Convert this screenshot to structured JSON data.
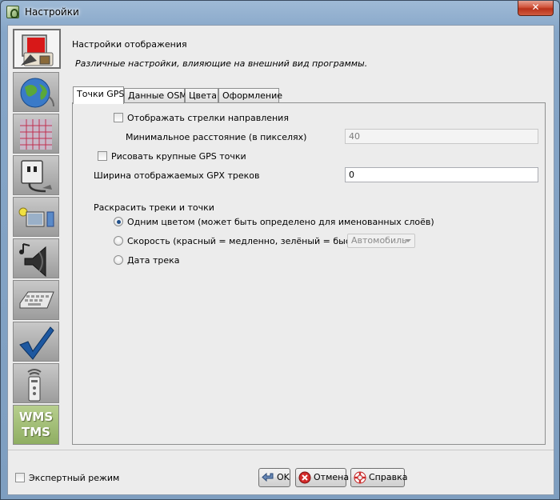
{
  "window": {
    "title": "Настройки",
    "close_glyph": "✕"
  },
  "categories": [
    {
      "icon": "display-settings-icon"
    },
    {
      "icon": "globe-icon"
    },
    {
      "icon": "projection-grid-icon"
    },
    {
      "icon": "plugin-icon"
    },
    {
      "icon": "folders-icon"
    },
    {
      "icon": "audio-icon"
    },
    {
      "icon": "keyboard-icon"
    },
    {
      "icon": "validator-checkmark-icon"
    },
    {
      "icon": "remote-control-icon"
    },
    {
      "icon": "wms-tms-icon",
      "label_line1": "WMS",
      "label_line2": "TMS"
    }
  ],
  "panel": {
    "title": "Настройки отображения",
    "description": "Различные настройки, влияющие на внешний вид программы."
  },
  "tabs": [
    {
      "label": "Точки GPS",
      "active": true
    },
    {
      "label": "Данные OSM",
      "active": false
    },
    {
      "label": "Цвета",
      "active": false
    },
    {
      "label": "Оформление",
      "active": false
    }
  ],
  "gps": {
    "show_direction_arrows_label": "Отображать стрелки направления",
    "show_direction_arrows": false,
    "min_distance_label": "Минимальное расстояние (в пикселях)",
    "min_distance_value": "40",
    "draw_large_points_label": "Рисовать крупные GPS точки",
    "draw_large_points": false,
    "track_width_label": "Ширина отображаемых GPX треков",
    "track_width_value": "0",
    "color_section_label": "Раскрасить треки и точки",
    "color_options": [
      {
        "label": "Одним цветом (может быть определено для именованных слоёв)",
        "selected": true
      },
      {
        "label": "Скорость (красный = медленно, зелёный = быстро)",
        "selected": false
      },
      {
        "label": "Дата трека",
        "selected": false
      }
    ],
    "speed_profile_value": "Автомобиль"
  },
  "footer": {
    "expert_mode_label": "Экспертный режим",
    "expert_mode": false,
    "ok_label": "OK",
    "cancel_label": "Отмена",
    "help_label": "Справка"
  },
  "colors": {
    "close_button": "#c8462c",
    "active_radio": "#1e4f8a"
  }
}
